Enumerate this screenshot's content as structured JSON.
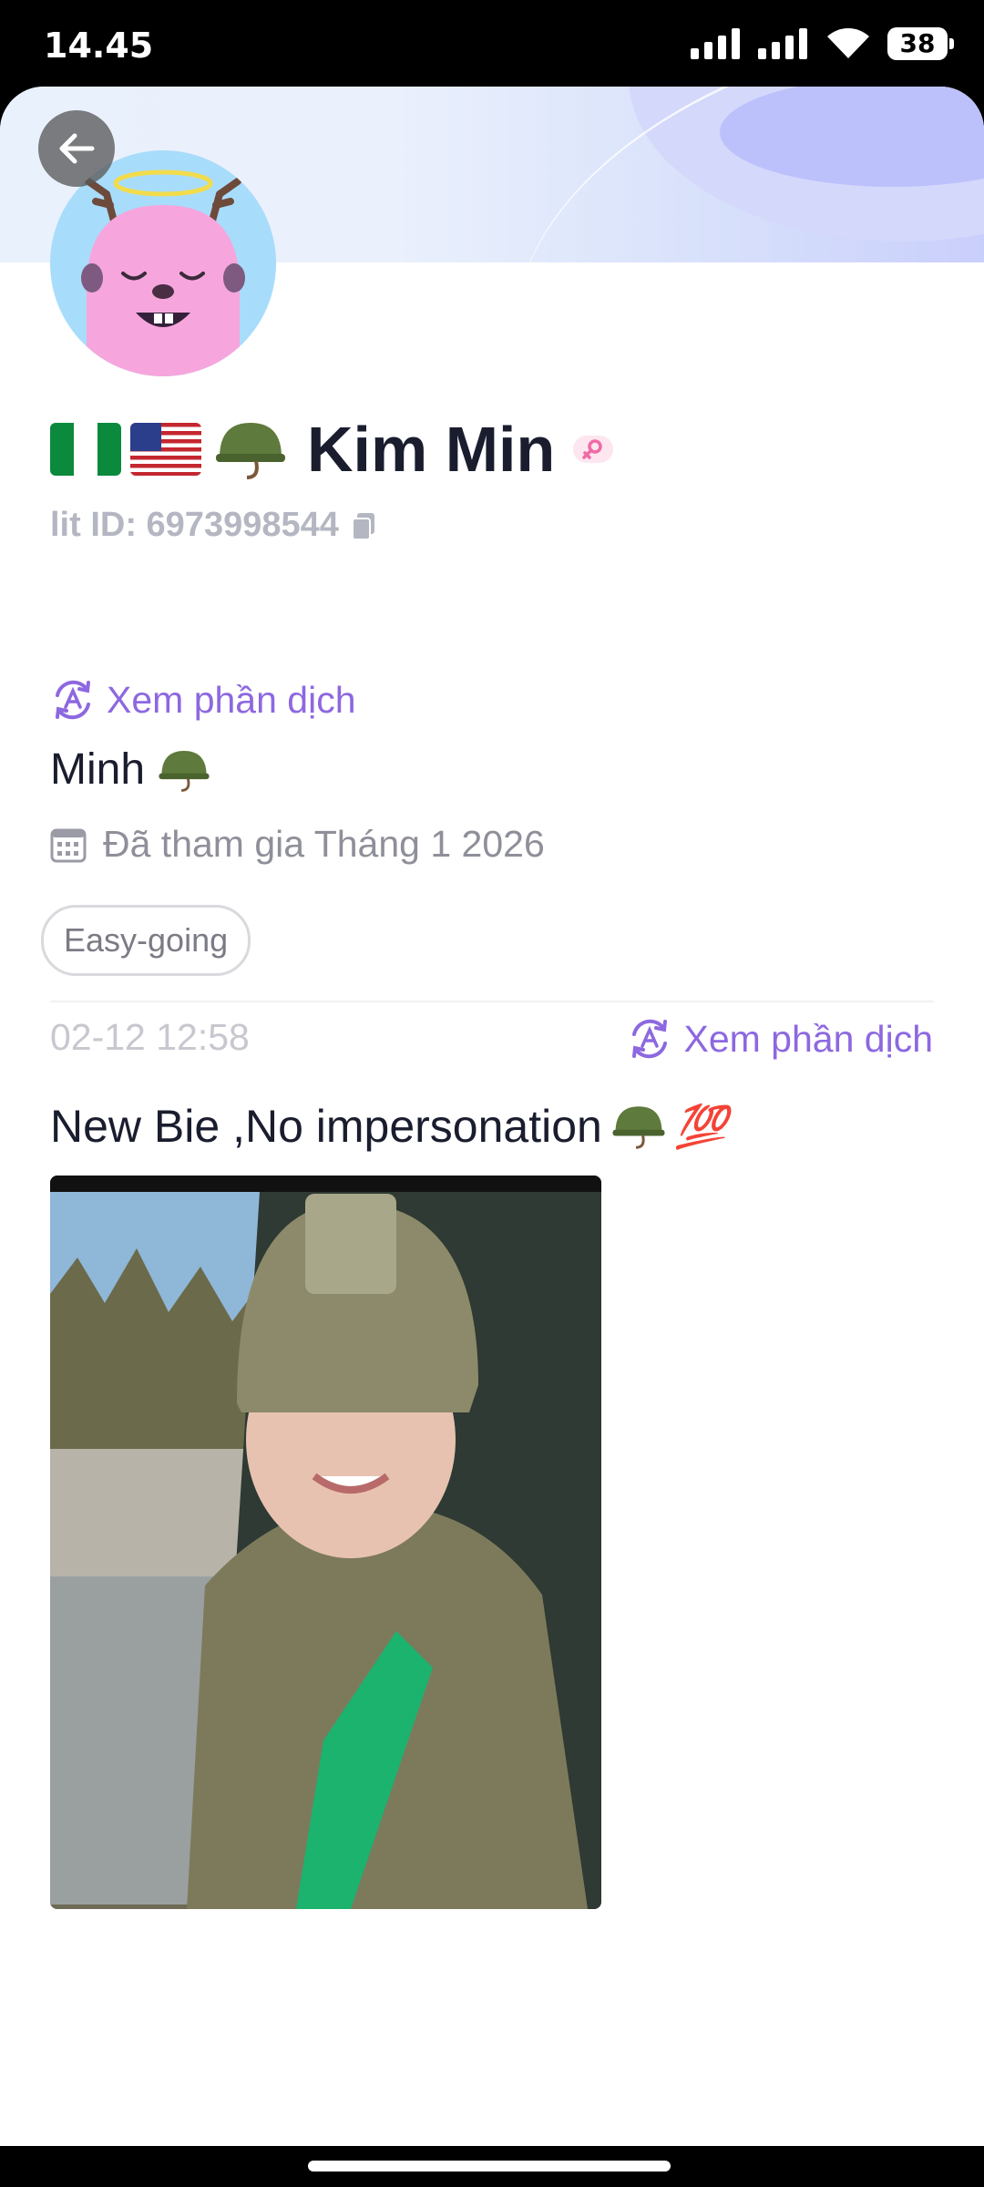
{
  "status_bar": {
    "time": "14.45",
    "battery": "38"
  },
  "header": {
    "back_label": "Back"
  },
  "profile": {
    "name": "Kim Min",
    "lit_id": "lit ID: 6973998544",
    "translate_label": "Xem phần dịch",
    "bio": "Minh",
    "joined": "Đã tham gia Tháng 1 2026",
    "tag": "Easy-going"
  },
  "post": {
    "timestamp": "02-12 12:58",
    "translate_label": "Xem phần dịch",
    "text": "New Bie ,No impersonation",
    "hundred_emoji": "💯"
  },
  "colors": {
    "accent": "#8d68e0",
    "name": "#1a1d2e",
    "muted": "#8e8f99"
  },
  "icons": [
    "back-arrow-icon",
    "translate-icon",
    "calendar-icon",
    "copy-icon",
    "female-icon",
    "helmet-icon"
  ]
}
